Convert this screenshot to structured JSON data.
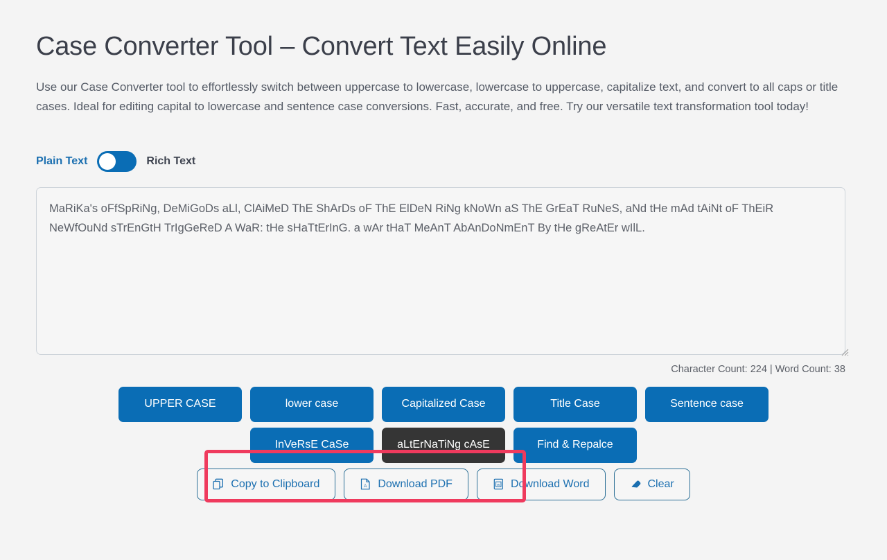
{
  "page": {
    "title": "Case Converter Tool – Convert Text Easily Online",
    "description": "Use our Case Converter tool to effortlessly switch between uppercase to lowercase, lowercase to uppercase, capitalize text, and convert to all caps or title cases. Ideal for editing capital to lowercase and sentence case conversions. Fast, accurate, and free. Try our versatile text transformation tool today!"
  },
  "mode_toggle": {
    "left_label": "Plain Text",
    "right_label": "Rich Text",
    "state": "Plain Text",
    "active_color": "#0a6db5"
  },
  "editor": {
    "value": "MaRiKa's oFfSpRiNg, DeMiGoDs aLl, ClAiMeD ThE ShArDs oF ThE ElDeN RiNg kNoWn aS ThE GrEaT RuNeS, aNd tHe mAd tAiNt oF ThEiR NeWfOuNd sTrEnGtH TrIgGeReD A WaR: tHe sHaTtErInG. a wAr tHaT MeAnT AbAnDoNmEnT By tHe gReAtEr wIlL.",
    "placeholder": "",
    "counter": "Character Count: 224 | Word Count: 38",
    "character_count": 224,
    "word_count": 38
  },
  "case_buttons_row1": [
    {
      "label": "UPPER CASE",
      "state": "default"
    },
    {
      "label": "lower case",
      "state": "default"
    },
    {
      "label": "Capitalized Case",
      "state": "default"
    },
    {
      "label": "Title Case",
      "state": "default"
    },
    {
      "label": "Sentence case",
      "state": "default"
    }
  ],
  "case_buttons_row2": [
    {
      "label": "InVeRsE CaSe",
      "state": "default"
    },
    {
      "label": "aLtErNaTiNg cAsE",
      "state": "active"
    },
    {
      "label": "Find & Repalce",
      "state": "default"
    }
  ],
  "action_buttons": [
    {
      "label": "Copy to Clipboard",
      "icon": "copy-icon"
    },
    {
      "label": "Download PDF",
      "icon": "pdf-file-icon"
    },
    {
      "label": "Download Word",
      "icon": "word-file-icon"
    },
    {
      "label": "Clear",
      "icon": "eraser-icon"
    }
  ],
  "highlight": {
    "color": "#ef3a5d",
    "targets": "InVeRsE CaSe, aLtErNaTiNg cAsE"
  },
  "colors": {
    "primary_blue": "#0a6db5",
    "active_dark": "#353535",
    "highlight_red": "#ef3a5d",
    "background": "#f4f4f4"
  }
}
